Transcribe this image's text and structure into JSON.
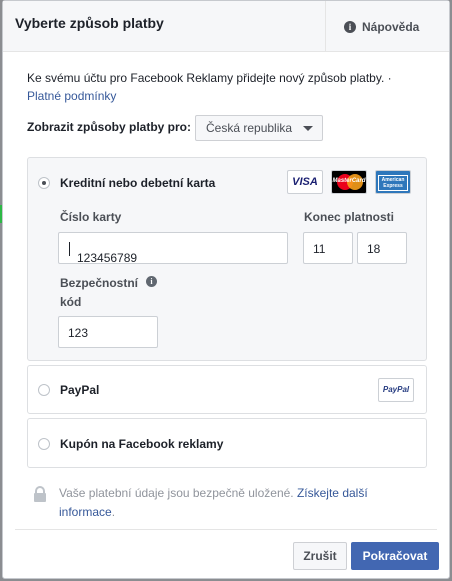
{
  "header": {
    "title": "Vyberte způsob platby",
    "help_label": "Nápověda",
    "help_icon": "info-circle-icon"
  },
  "intro": {
    "text": "Ke svému účtu pro Facebook Reklamy přidejte nový způsob platby. ·",
    "terms_link": "Platné podmínky"
  },
  "country": {
    "label": "Zobrazit způsoby platby pro:",
    "selected": "Česká republika"
  },
  "payment_options": {
    "card": {
      "label": "Kreditní nebo debetní karta",
      "selected": true,
      "logos": [
        "VISA",
        "MasterCard",
        "American Express"
      ],
      "card_number_label": "Číslo karty",
      "card_number_value": "123456789",
      "expiry_label": "Konec platnosti",
      "expiry_month": "11",
      "expiry_year": "18",
      "cvc_label": "Bezpečnostní kód",
      "cvc_value": "123"
    },
    "paypal": {
      "label": "PayPal",
      "logo": "PayPal",
      "selected": false
    },
    "coupon": {
      "label": "Kupón na Facebook reklamy",
      "selected": false
    }
  },
  "security_note": {
    "text": "Vaše platební údaje jsou bezpečně uložené.",
    "link": "Získejte další informace",
    "end": "."
  },
  "buttons": {
    "cancel": "Zrušit",
    "continue": "Pokračovat"
  },
  "colors": {
    "primary": "#4267b2",
    "link": "#365899",
    "header_bg": "#f6f7f9",
    "backdrop": "#8b8d91"
  }
}
